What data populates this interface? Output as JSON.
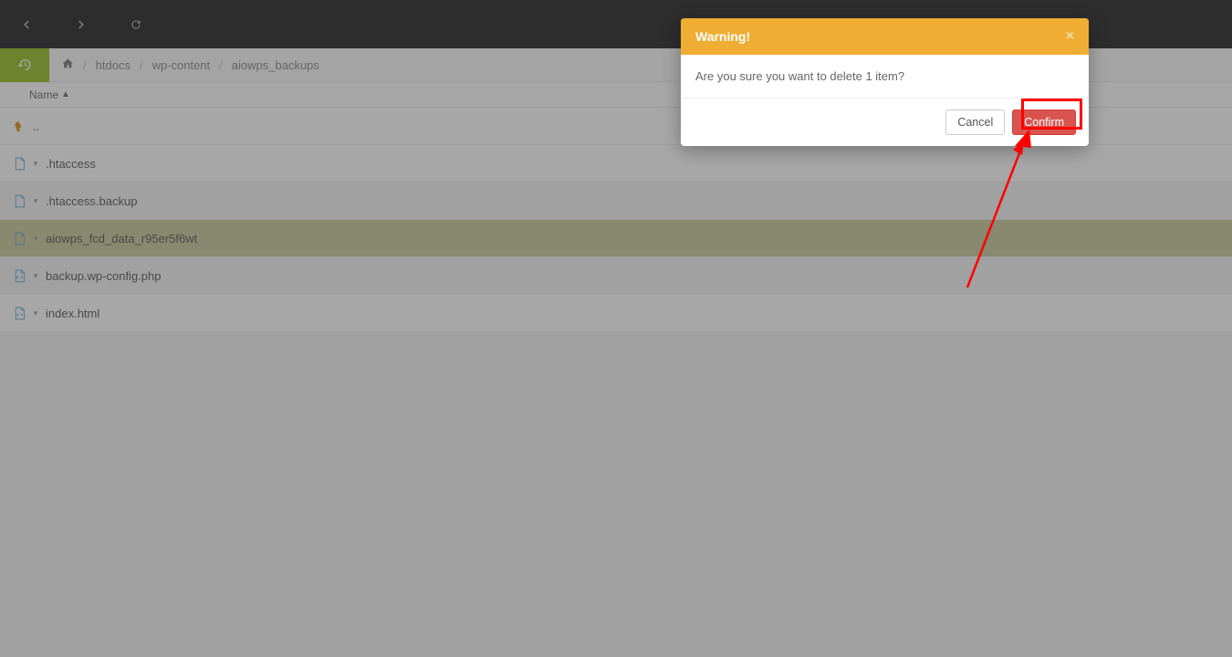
{
  "breadcrumb": {
    "items": [
      "htdocs",
      "wp-content",
      "aiowps_backups"
    ]
  },
  "columns": {
    "name": "Name"
  },
  "parent_label": "..",
  "files": [
    {
      "name": ".htaccess",
      "type": "file",
      "selected": false,
      "alt": false
    },
    {
      "name": ".htaccess.backup",
      "type": "file",
      "selected": false,
      "alt": true
    },
    {
      "name": "aiowps_fcd_data_r95er5f6wt",
      "type": "file",
      "selected": true,
      "alt": false
    },
    {
      "name": "backup.wp-config.php",
      "type": "code",
      "selected": false,
      "alt": true
    },
    {
      "name": "index.html",
      "type": "code",
      "selected": false,
      "alt": false
    }
  ],
  "modal": {
    "title": "Warning!",
    "message": "Are you sure you want to delete 1 item?",
    "cancel": "Cancel",
    "confirm": "Confirm"
  }
}
